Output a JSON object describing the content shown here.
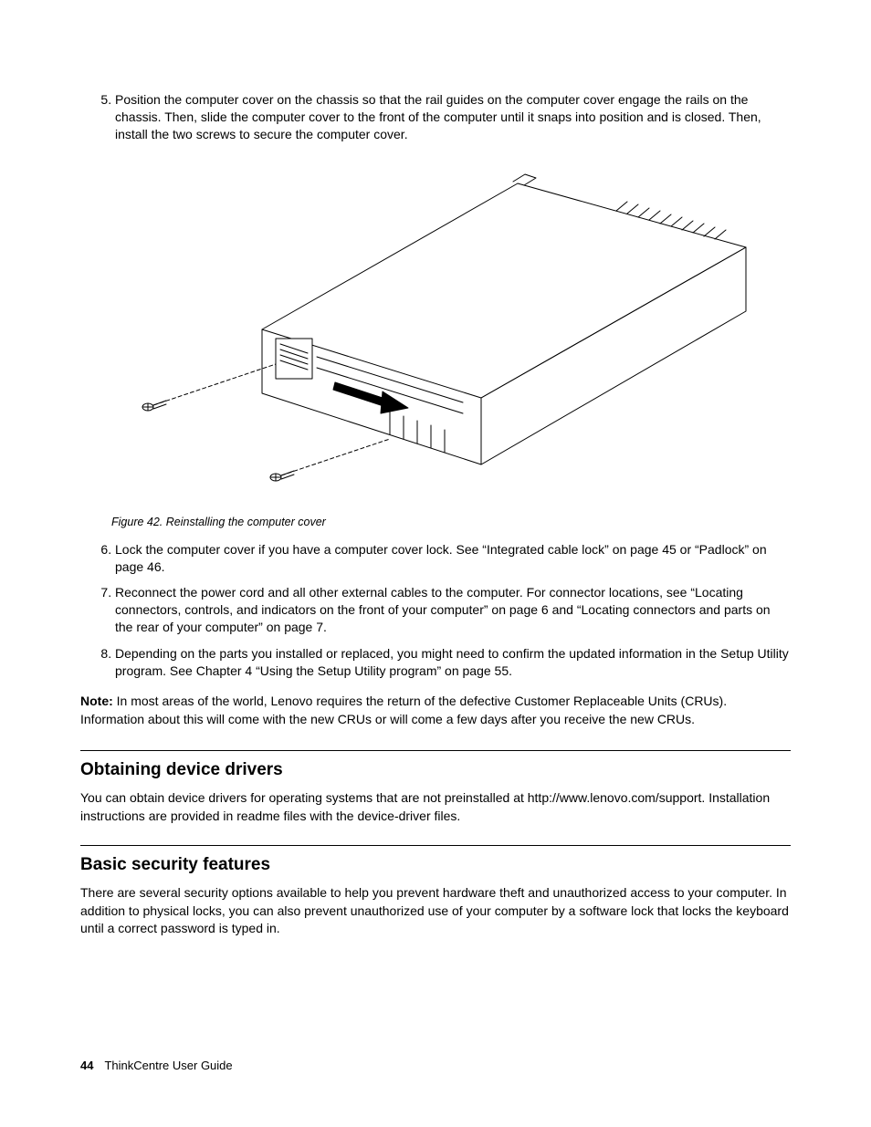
{
  "steps_a": [
    {
      "n": "5",
      "text": "Position the computer cover on the chassis so that the rail guides on the computer cover engage the rails on the chassis. Then, slide the computer cover to the front of the computer until it snaps into position and is closed. Then, install the two screws to secure the computer cover."
    }
  ],
  "figure_caption": "Figure 42.  Reinstalling the computer cover",
  "steps_b": [
    {
      "n": "6",
      "text": "Lock the computer cover if you have a computer cover lock. See “Integrated cable lock” on page 45 or “Padlock” on page 46."
    },
    {
      "n": "7",
      "text": "Reconnect the power cord and all other external cables to the computer. For connector locations, see “Locating connectors, controls, and indicators on the front of your computer” on page 6 and “Locating connectors and parts on the rear of your computer” on page 7."
    },
    {
      "n": "8",
      "text": "Depending on the parts you installed or replaced, you might need to confirm the updated information in the Setup Utility program. See Chapter 4 “Using the Setup Utility program” on page 55."
    }
  ],
  "note_label": "Note:",
  "note_text": " In most areas of the world, Lenovo requires the return of the defective Customer Replaceable Units (CRUs). Information about this will come with the new CRUs or will come a few days after you receive the new CRUs.",
  "section1": {
    "title": "Obtaining device drivers",
    "body": "You can obtain device drivers for operating systems that are not preinstalled at http://www.lenovo.com/support. Installation instructions are provided in readme files with the device-driver files."
  },
  "section2": {
    "title": "Basic security features",
    "body": "There are several security options available to help you prevent hardware theft and unauthorized access to your computer. In addition to physical locks, you can also prevent unauthorized use of your computer by a software lock that locks the keyboard until a correct password is typed in."
  },
  "footer": {
    "page_number": "44",
    "doc_title": "ThinkCentre User Guide"
  }
}
